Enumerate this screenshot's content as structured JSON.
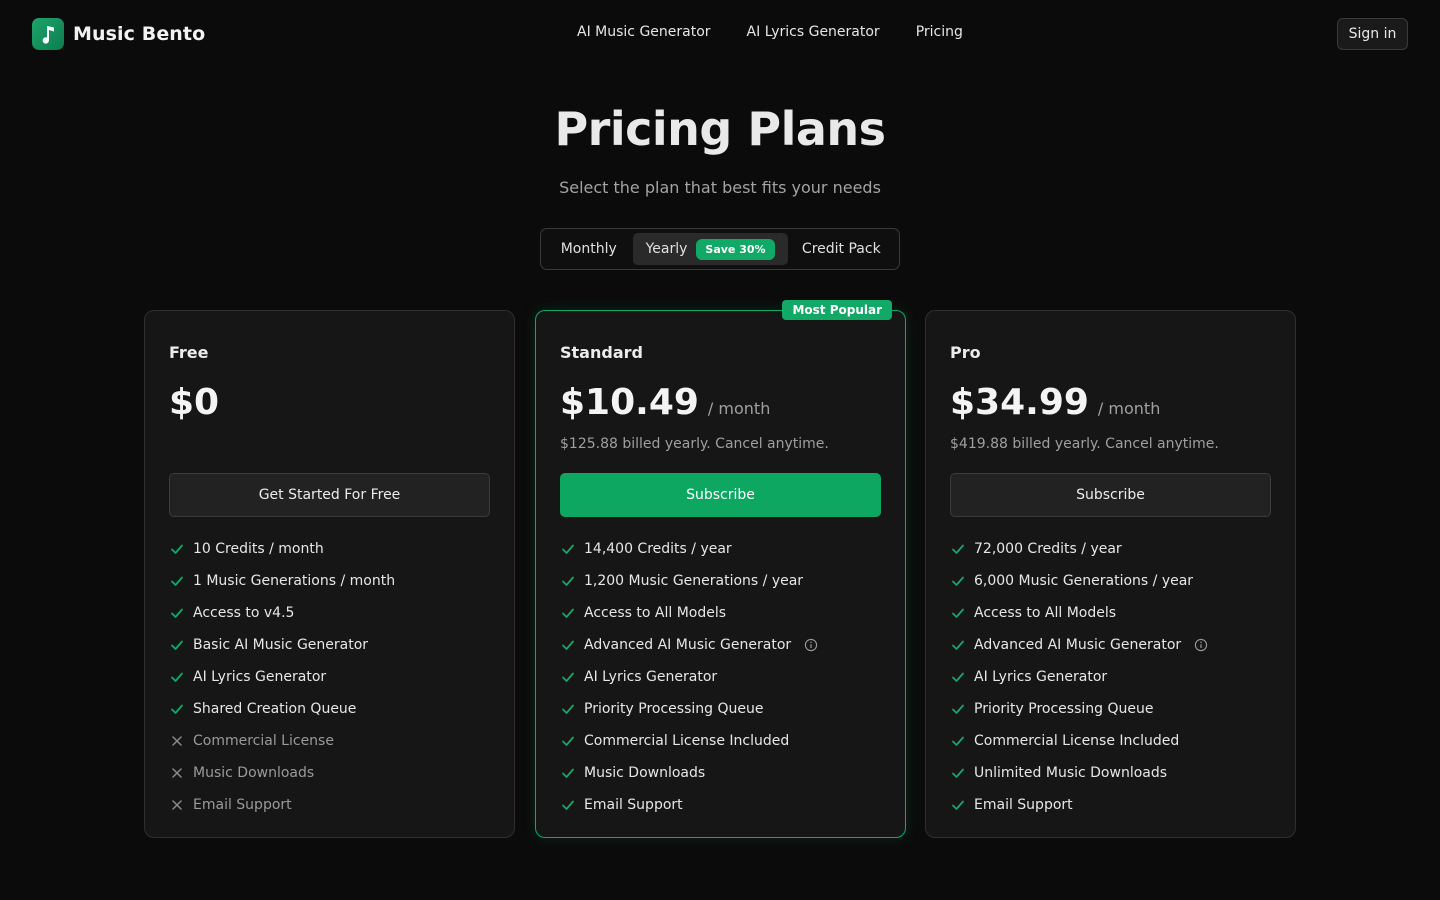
{
  "brand": {
    "name": "Music Bento",
    "logo_icon": "music-note-icon",
    "accent": "#12a866"
  },
  "nav": {
    "items": [
      {
        "label": "AI Music Generator"
      },
      {
        "label": "AI Lyrics Generator"
      },
      {
        "label": "Pricing"
      }
    ],
    "signin_label": "Sign in"
  },
  "hero": {
    "title": "Pricing Plans",
    "subtitle": "Select the plan that best fits your needs"
  },
  "billing_toggle": {
    "options": [
      "Monthly",
      "Yearly",
      "Credit Pack"
    ],
    "selected": "Yearly",
    "save_badge": "Save 30%"
  },
  "plans": [
    {
      "name": "Free",
      "price": "$0",
      "period": "",
      "billing_note": "",
      "cta": "Get Started For Free",
      "features": [
        {
          "text": "10 Credits / month",
          "included": true
        },
        {
          "text": "1 Music Generations / month",
          "included": true
        },
        {
          "text": "Access to v4.5",
          "included": true
        },
        {
          "text": "Basic AI Music Generator",
          "included": true
        },
        {
          "text": "AI Lyrics Generator",
          "included": true
        },
        {
          "text": "Shared Creation Queue",
          "included": true
        },
        {
          "text": "Commercial License",
          "included": false
        },
        {
          "text": "Music Downloads",
          "included": false
        },
        {
          "text": "Email Support",
          "included": false
        }
      ]
    },
    {
      "name": "Standard",
      "badge": "Most Popular",
      "price": "$10.49",
      "period": "/ month",
      "billing_note": "$125.88 billed yearly. Cancel anytime.",
      "cta": "Subscribe",
      "features": [
        {
          "text": "14,400 Credits / year",
          "included": true
        },
        {
          "text": "1,200 Music Generations / year",
          "included": true
        },
        {
          "text": "Access to All Models",
          "included": true
        },
        {
          "text": "Advanced AI Music Generator",
          "included": true,
          "info": true
        },
        {
          "text": "AI Lyrics Generator",
          "included": true
        },
        {
          "text": "Priority Processing Queue",
          "included": true
        },
        {
          "text": "Commercial License Included",
          "included": true
        },
        {
          "text": "Music Downloads",
          "included": true
        },
        {
          "text": "Email Support",
          "included": true
        }
      ]
    },
    {
      "name": "Pro",
      "price": "$34.99",
      "period": "/ month",
      "billing_note": "$419.88 billed yearly. Cancel anytime.",
      "cta": "Subscribe",
      "features": [
        {
          "text": "72,000 Credits / year",
          "included": true
        },
        {
          "text": "6,000 Music Generations / year",
          "included": true
        },
        {
          "text": "Access to All Models",
          "included": true
        },
        {
          "text": "Advanced AI Music Generator",
          "included": true,
          "info": true
        },
        {
          "text": "AI Lyrics Generator",
          "included": true
        },
        {
          "text": "Priority Processing Queue",
          "included": true
        },
        {
          "text": "Commercial License Included",
          "included": true
        },
        {
          "text": "Unlimited Music Downloads",
          "included": true
        },
        {
          "text": "Email Support",
          "included": true
        }
      ]
    }
  ]
}
